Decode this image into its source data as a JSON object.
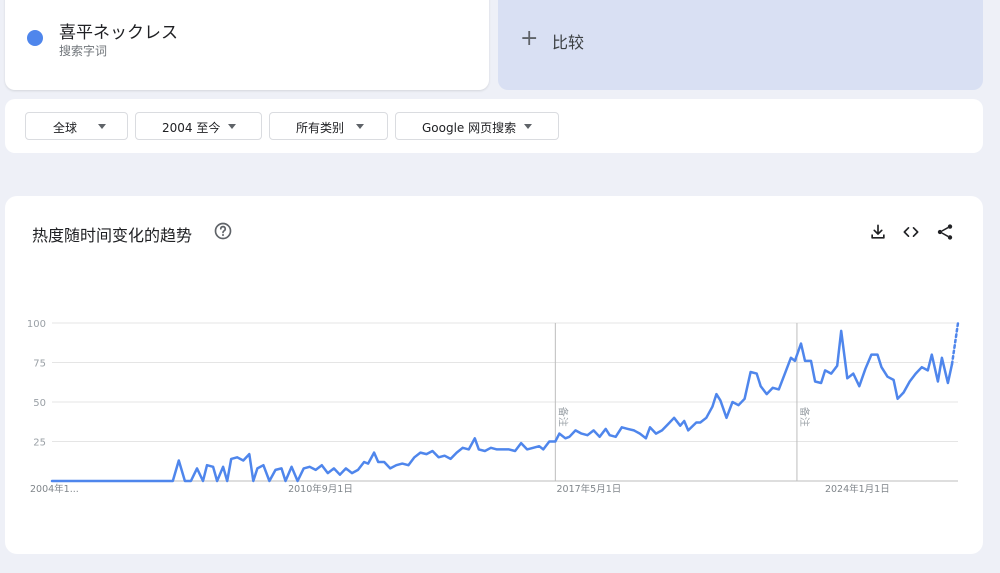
{
  "search_term": {
    "name": "喜平ネックレス",
    "subtitle": "搜索字词",
    "color": "#4f86ec"
  },
  "compare": {
    "icon": "plus-icon",
    "label": "比较"
  },
  "filters": [
    {
      "label": "全球",
      "icon": "caret-down-icon"
    },
    {
      "label": "2004 至今",
      "icon": "caret-down-icon"
    },
    {
      "label": "所有类别",
      "icon": "caret-down-icon"
    },
    {
      "label": "Google 网页搜索",
      "icon": "caret-down-icon"
    }
  ],
  "chart_panel": {
    "title": "热度随时间变化的趋势",
    "help_icon": "help-circle-icon",
    "tools": [
      "download-icon",
      "embed-code-icon",
      "share-icon"
    ]
  },
  "chart_data": {
    "type": "line",
    "title": "",
    "xlabel": "",
    "ylabel": "",
    "x_tick_labels": [
      "2004年1...",
      "2010年9月1日",
      "2017年5月1日",
      "2024年1月1日"
    ],
    "x_tick_years": [
      2004.0,
      2010.667,
      2017.333,
      2024.0
    ],
    "y_ticks": [
      100,
      75,
      50,
      25
    ],
    "ylim": [
      0,
      100
    ],
    "grid": true,
    "annotation_label": "备注",
    "annotations_years": [
      2016.5,
      2022.5
    ],
    "series": [
      {
        "color": "#4f86ec",
        "points": [
          [
            2004.0,
            0
          ],
          [
            2004.5,
            0
          ],
          [
            2005.0,
            0
          ],
          [
            2005.5,
            0
          ],
          [
            2006.0,
            0
          ],
          [
            2006.5,
            0
          ],
          [
            2007.0,
            0
          ],
          [
            2007.15,
            13
          ],
          [
            2007.3,
            0
          ],
          [
            2007.45,
            0
          ],
          [
            2007.6,
            8
          ],
          [
            2007.75,
            0
          ],
          [
            2007.85,
            10
          ],
          [
            2008.0,
            9
          ],
          [
            2008.1,
            0
          ],
          [
            2008.25,
            9
          ],
          [
            2008.35,
            0
          ],
          [
            2008.45,
            14
          ],
          [
            2008.6,
            15
          ],
          [
            2008.75,
            13
          ],
          [
            2008.9,
            17
          ],
          [
            2009.0,
            0
          ],
          [
            2009.1,
            8
          ],
          [
            2009.25,
            10
          ],
          [
            2009.4,
            0
          ],
          [
            2009.55,
            7
          ],
          [
            2009.7,
            8
          ],
          [
            2009.8,
            0
          ],
          [
            2009.95,
            9
          ],
          [
            2010.1,
            0
          ],
          [
            2010.25,
            8
          ],
          [
            2010.4,
            9
          ],
          [
            2010.55,
            7
          ],
          [
            2010.7,
            10
          ],
          [
            2010.85,
            5
          ],
          [
            2011.0,
            8
          ],
          [
            2011.15,
            4
          ],
          [
            2011.3,
            8
          ],
          [
            2011.45,
            5
          ],
          [
            2011.6,
            7
          ],
          [
            2011.75,
            12
          ],
          [
            2011.85,
            11
          ],
          [
            2012.0,
            18
          ],
          [
            2012.1,
            12
          ],
          [
            2012.25,
            12
          ],
          [
            2012.4,
            8
          ],
          [
            2012.55,
            10
          ],
          [
            2012.7,
            11
          ],
          [
            2012.85,
            10
          ],
          [
            2013.0,
            15
          ],
          [
            2013.15,
            18
          ],
          [
            2013.3,
            17
          ],
          [
            2013.45,
            19
          ],
          [
            2013.6,
            15
          ],
          [
            2013.75,
            16
          ],
          [
            2013.9,
            14
          ],
          [
            2014.05,
            18
          ],
          [
            2014.2,
            21
          ],
          [
            2014.35,
            20
          ],
          [
            2014.5,
            27
          ],
          [
            2014.6,
            20
          ],
          [
            2014.75,
            19
          ],
          [
            2014.9,
            21
          ],
          [
            2015.05,
            20
          ],
          [
            2015.2,
            20
          ],
          [
            2015.35,
            20
          ],
          [
            2015.5,
            19
          ],
          [
            2015.65,
            24
          ],
          [
            2015.8,
            20
          ],
          [
            2015.95,
            21
          ],
          [
            2016.1,
            22
          ],
          [
            2016.2,
            20
          ],
          [
            2016.35,
            25
          ],
          [
            2016.5,
            25
          ],
          [
            2016.6,
            30
          ],
          [
            2016.75,
            27
          ],
          [
            2016.85,
            28
          ],
          [
            2017.0,
            32
          ],
          [
            2017.15,
            30
          ],
          [
            2017.3,
            29
          ],
          [
            2017.45,
            32
          ],
          [
            2017.6,
            28
          ],
          [
            2017.75,
            33
          ],
          [
            2017.85,
            29
          ],
          [
            2018.0,
            28
          ],
          [
            2018.15,
            34
          ],
          [
            2018.3,
            33
          ],
          [
            2018.45,
            32
          ],
          [
            2018.6,
            30
          ],
          [
            2018.75,
            27
          ],
          [
            2018.85,
            34
          ],
          [
            2019.0,
            30
          ],
          [
            2019.15,
            32
          ],
          [
            2019.3,
            36
          ],
          [
            2019.45,
            40
          ],
          [
            2019.6,
            35
          ],
          [
            2019.7,
            38
          ],
          [
            2019.8,
            32
          ],
          [
            2020.0,
            37
          ],
          [
            2020.1,
            37
          ],
          [
            2020.25,
            40
          ],
          [
            2020.4,
            47
          ],
          [
            2020.5,
            55
          ],
          [
            2020.6,
            51
          ],
          [
            2020.75,
            40
          ],
          [
            2020.9,
            50
          ],
          [
            2021.05,
            48
          ],
          [
            2021.2,
            52
          ],
          [
            2021.35,
            69
          ],
          [
            2021.5,
            68
          ],
          [
            2021.6,
            60
          ],
          [
            2021.75,
            55
          ],
          [
            2021.9,
            59
          ],
          [
            2022.05,
            58
          ],
          [
            2022.2,
            68
          ],
          [
            2022.35,
            78
          ],
          [
            2022.45,
            76
          ],
          [
            2022.6,
            87
          ],
          [
            2022.7,
            76
          ],
          [
            2022.85,
            76
          ],
          [
            2022.95,
            63
          ],
          [
            2023.1,
            62
          ],
          [
            2023.2,
            70
          ],
          [
            2023.35,
            68
          ],
          [
            2023.5,
            73
          ],
          [
            2023.6,
            95
          ],
          [
            2023.75,
            65
          ],
          [
            2023.9,
            68
          ],
          [
            2024.05,
            60
          ],
          [
            2024.2,
            71
          ],
          [
            2024.35,
            80
          ],
          [
            2024.5,
            80
          ],
          [
            2024.6,
            72
          ],
          [
            2024.75,
            66
          ],
          [
            2024.9,
            64
          ],
          [
            2025.0,
            52
          ],
          [
            2025.15,
            56
          ],
          [
            2025.3,
            63
          ],
          [
            2025.45,
            68
          ],
          [
            2025.6,
            72
          ],
          [
            2025.75,
            70
          ],
          [
            2025.85,
            80
          ],
          [
            2026.0,
            63
          ],
          [
            2026.1,
            78
          ],
          [
            2026.25,
            62
          ],
          [
            2026.35,
            74
          ]
        ],
        "partial_points": [
          [
            2026.35,
            74
          ],
          [
            2026.5,
            100
          ]
        ]
      }
    ]
  }
}
